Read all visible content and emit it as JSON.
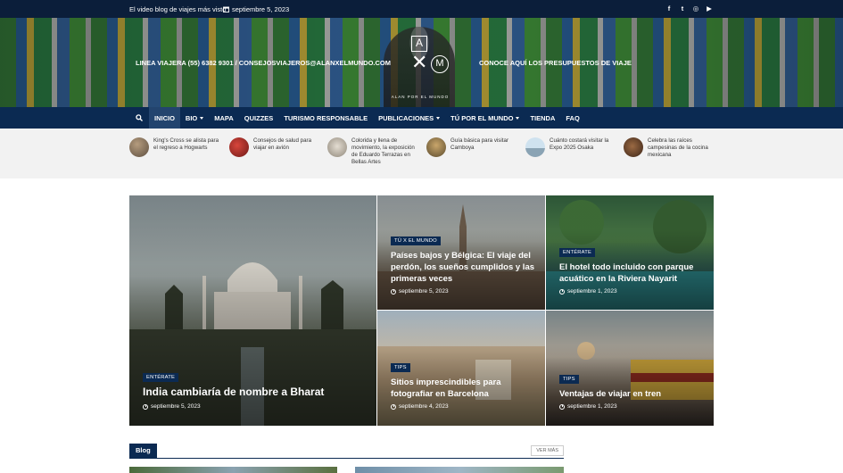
{
  "topbar": {
    "tagline": "El video blog de viajes más visto",
    "date": "septiembre 5, 2023",
    "social": [
      {
        "icon": "facebook-icon",
        "glyph": "f"
      },
      {
        "icon": "twitter-icon",
        "glyph": "t"
      },
      {
        "icon": "instagram-icon",
        "glyph": "◎"
      },
      {
        "icon": "youtube-icon",
        "glyph": "▶"
      }
    ]
  },
  "banner": {
    "left_text": "LINEA VIAJERA (55) 6382 9301 / CONSEJOSVIAJEROS@ALANXELMUNDO.COM",
    "right_text": "CONOCE AQUÍ LOS PRESUPUESTOS DE VIAJE",
    "logo": {
      "a": "A",
      "x": "✕",
      "m": "M",
      "caption": "ALAN POR EL MUNDO"
    }
  },
  "nav": {
    "items": [
      {
        "label": "INICIO",
        "active": true,
        "dropdown": false
      },
      {
        "label": "BIO",
        "active": false,
        "dropdown": true
      },
      {
        "label": "MAPA",
        "active": false,
        "dropdown": false
      },
      {
        "label": "QUIZZES",
        "active": false,
        "dropdown": false
      },
      {
        "label": "TURISMO RESPONSABLE",
        "active": false,
        "dropdown": false
      },
      {
        "label": "PUBLICACIONES",
        "active": false,
        "dropdown": true
      },
      {
        "label": "TÚ POR EL MUNDO",
        "active": false,
        "dropdown": true
      },
      {
        "label": "TIENDA",
        "active": false,
        "dropdown": false
      },
      {
        "label": "FAQ",
        "active": false,
        "dropdown": false
      }
    ]
  },
  "trending": [
    {
      "text": "King's Cross se alista para el regreso a Hogwarts",
      "color": "#7a6a58"
    },
    {
      "text": "Consejos de salud para viajar en avión",
      "color": "#a0302a"
    },
    {
      "text": "Colorida y llena de movimiento, la exposición de Eduardo Terrazas en Bellas Artes",
      "color": "#b9b3a8"
    },
    {
      "text": "Guía básica para visitar Camboya",
      "color": "#8c7a55"
    },
    {
      "text": "Cuánto costará visitar la Expo 2025 Osaka",
      "color": "#9fb7c9"
    },
    {
      "text": "Celebra las raíces campesinas de la cocina mexicana",
      "color": "#6a4a35"
    }
  ],
  "hero": [
    {
      "badge": "ENTÉRATE",
      "title": "India cambiaría de nombre a Bharat",
      "date": "septiembre 5, 2023"
    },
    {
      "badge": "TÚ X EL MUNDO",
      "title": "Países bajos y Bélgica: El viaje del perdón, los sueños cumplidos y las primeras veces",
      "date": "septiembre 5, 2023"
    },
    {
      "badge": "ENTÉRATE",
      "title": "El hotel todo incluido con parque acuático en la Riviera Nayarit",
      "date": "septiembre 1, 2023"
    },
    {
      "badge": "TIPS",
      "title": "Sitios imprescindibles para fotografiar en Barcelona",
      "date": "septiembre 4, 2023"
    },
    {
      "badge": "TIPS",
      "title": "Ventajas de viajar en tren",
      "date": "septiembre 1, 2023"
    }
  ],
  "blog": {
    "label": "Blog",
    "more": "VER MÁS"
  }
}
